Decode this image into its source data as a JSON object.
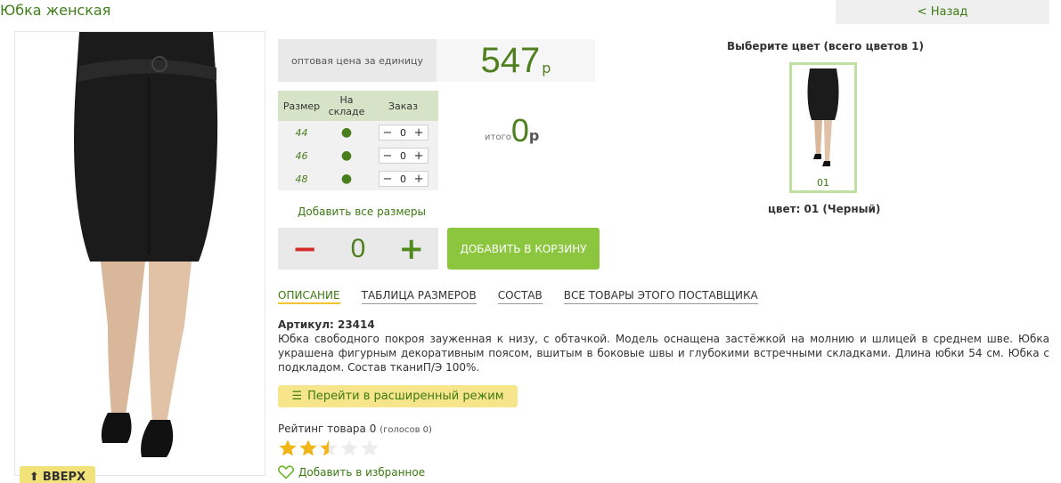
{
  "header": {
    "title": "Юбка женская",
    "back_label": "< Назад"
  },
  "price": {
    "label": "оптовая цена за единицу",
    "value": "547",
    "currency": "р"
  },
  "sizes_table": {
    "headers": {
      "size": "Размер",
      "stock_line1": "На",
      "stock_line2": "складе",
      "order": "Заказ"
    },
    "rows": [
      {
        "size": "44",
        "stock": "●",
        "qty": "0"
      },
      {
        "size": "46",
        "stock": "●",
        "qty": "0"
      },
      {
        "size": "48",
        "stock": "●",
        "qty": "0"
      }
    ]
  },
  "total": {
    "label": "итого",
    "value": "0",
    "currency": "р"
  },
  "add_all_sizes": "Добавить все размеры",
  "quantity": {
    "minus": "−",
    "value": "0",
    "plus": "+"
  },
  "cart_button": "ДОБАВИТЬ В КОРЗИНУ",
  "tabs": [
    {
      "label": "ОПИСАНИЕ",
      "active": true
    },
    {
      "label": "ТАБЛИЦА РАЗМЕРОВ",
      "active": false
    },
    {
      "label": "СОСТАВ",
      "active": false
    },
    {
      "label": "ВСЕ ТОВАРЫ ЭТОГО ПОСТАВЩИКА",
      "active": false
    }
  ],
  "description": {
    "article": "Артикул: 23414",
    "text": "Юбка свободного покроя зауженная к низу, с обтачкой. Модель оснащена застёжкой на молнию и шлицей в среднем шве. Юбка украшена фигурным декоративным поясом, вшитым в боковые швы и глубокими встречными складками. Длина юбки 54 см. Юбка с подкладом. Состав тканиП/Э 100%."
  },
  "expand_button": "Перейти в расширенный режим",
  "rating": {
    "label": "Рейтинг товара 0",
    "votes": "(голосов 0)",
    "filled_stars": 2.5,
    "max_stars": 5
  },
  "favorite": "Добавить в избранное",
  "colors": {
    "heading": "Выберите цвет (всего цветов 1)",
    "swatches": [
      {
        "code": "01"
      }
    ],
    "selected": "цвет: 01 (Черный)"
  },
  "up_button": "ВВЕРХ",
  "theme": {
    "accent": "#8cc63f",
    "link": "#3c7a12",
    "price": "#4f7f1e",
    "minus": "#d62b2b",
    "star": "#f2b516"
  }
}
